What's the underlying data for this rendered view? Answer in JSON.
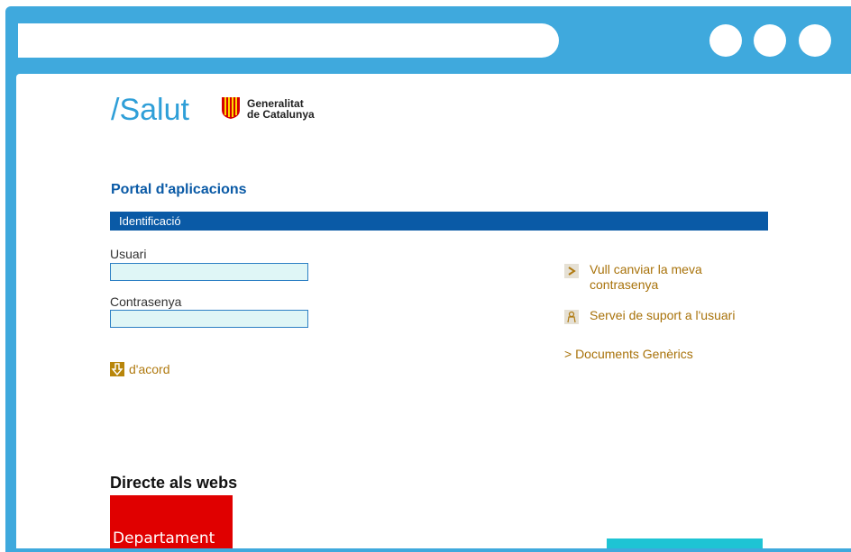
{
  "browser": {
    "url": "",
    "window_buttons": [
      "circle",
      "circle",
      "circle"
    ]
  },
  "header": {
    "salut_logo": "/Salut",
    "gencat_line1": "Generalitat",
    "gencat_line2": "de Catalunya"
  },
  "portal": {
    "title": "Portal d'aplicacions",
    "section": "Identificació"
  },
  "login": {
    "user_label": "Usuari",
    "user_value": "",
    "password_label": "Contrasenya",
    "password_value": "",
    "submit_label": "d'acord"
  },
  "links": {
    "change_password": "Vull canviar la meva contrasenya",
    "support": "Servei de suport a l'usuari",
    "documents": "> Documents Genèrics"
  },
  "directe": {
    "title": "Directe als webs",
    "dept_label": "Departament"
  },
  "colors": {
    "chrome": "#3fa9dd",
    "brand_blue": "#0a5aa6",
    "link_gold": "#a8720a",
    "dept_red": "#e00000",
    "cyan": "#1ec4d4"
  }
}
